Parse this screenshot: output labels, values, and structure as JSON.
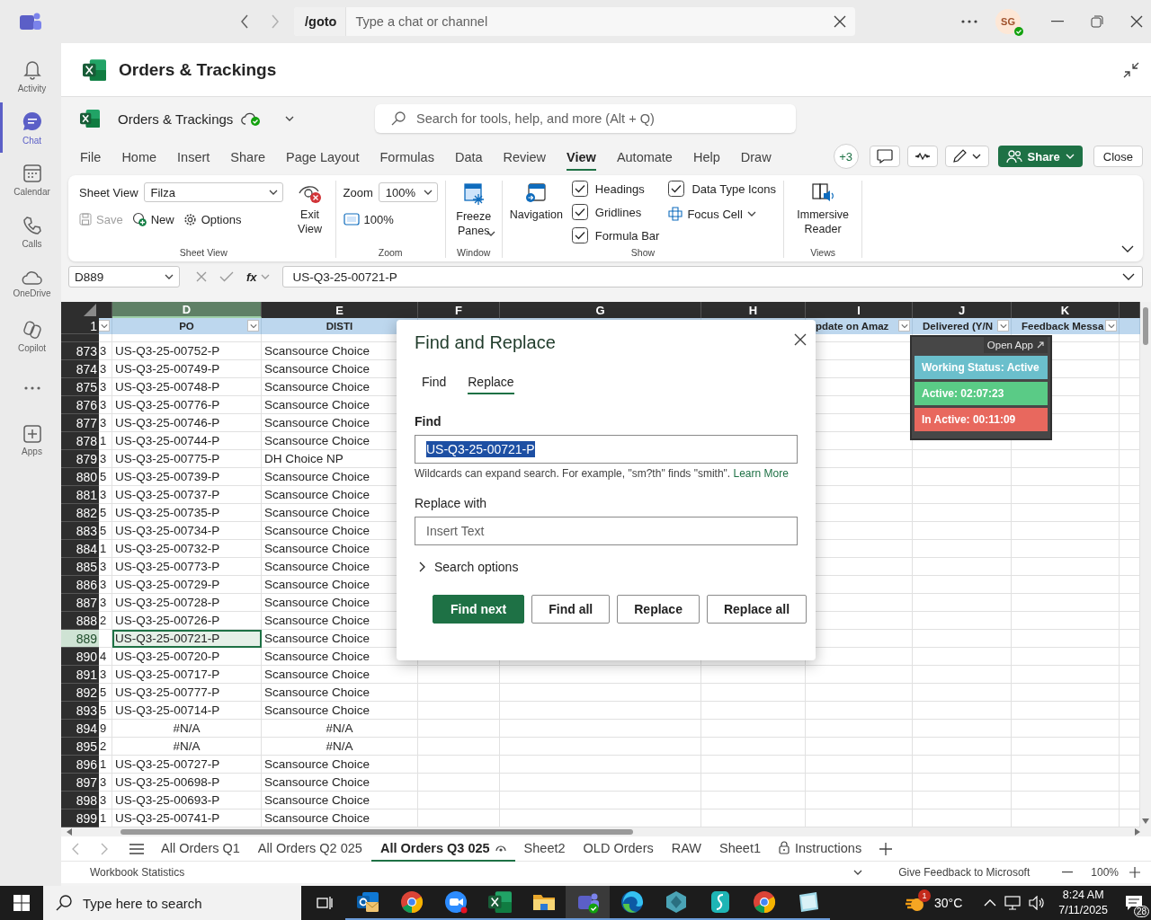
{
  "top": {
    "command": "/goto",
    "search_placeholder": "Type a chat or channel",
    "avatar": "SG"
  },
  "rail": [
    {
      "kind": "activity",
      "label": "Activity",
      "selected": false
    },
    {
      "kind": "chat",
      "label": "Chat",
      "selected": true
    },
    {
      "kind": "calendar",
      "label": "Calendar",
      "selected": false
    },
    {
      "kind": "calls",
      "label": "Calls",
      "selected": false
    },
    {
      "kind": "onedrive",
      "label": "OneDrive",
      "selected": false
    },
    {
      "kind": "copilot",
      "label": "Copilot",
      "selected": false
    },
    {
      "kind": "more",
      "selected": false
    },
    {
      "kind": "apps",
      "label": "Apps",
      "selected": false
    }
  ],
  "title": "Orders & Trackings",
  "workbook": {
    "name": "Orders & Trackings",
    "search_placeholder": "Search for tools, help, and more (Alt + Q)"
  },
  "menu": [
    {
      "label": "File",
      "selected": false
    },
    {
      "label": "Home",
      "selected": false
    },
    {
      "label": "Insert",
      "selected": false
    },
    {
      "label": "Share",
      "selected": false
    },
    {
      "label": "Page Layout",
      "selected": false
    },
    {
      "label": "Formulas",
      "selected": false
    },
    {
      "label": "Data",
      "selected": false
    },
    {
      "label": "Review",
      "selected": false
    },
    {
      "label": "View",
      "selected": true
    },
    {
      "label": "Automate",
      "selected": false
    },
    {
      "label": "Help",
      "selected": false
    },
    {
      "label": "Draw",
      "selected": false
    }
  ],
  "collaborators": "+3",
  "share": "Share",
  "close": "Close",
  "ribbon": {
    "sheet_view": {
      "label": "Sheet View",
      "value": "Filza",
      "actions": [
        {
          "label": "Save",
          "disabled": true
        },
        {
          "label": "New",
          "disabled": false
        },
        {
          "label": "Options",
          "disabled": false
        }
      ],
      "exit": "Exit View",
      "group": "Sheet View"
    },
    "zoom": {
      "label": "Zoom",
      "value": "100%",
      "reset": "100%",
      "group": "Zoom"
    },
    "window": {
      "freeze": "Freeze Panes",
      "group": "Window"
    },
    "show": {
      "navigation": "Navigation",
      "checks": [
        {
          "label": "Headings",
          "checked": true
        },
        {
          "label": "Gridlines",
          "checked": true
        },
        {
          "label": "Formula Bar",
          "checked": true
        },
        {
          "label": "Data Type Icons",
          "checked": true
        }
      ],
      "focus_cell": "Focus Cell",
      "group": "Show"
    },
    "views": {
      "immersive": "Immersive Reader",
      "group": "Views"
    }
  },
  "formula_bar": {
    "name_box": "D889",
    "function_label": "fx",
    "value": "US-Q3-25-00721-P"
  },
  "grid": {
    "header_row_number": "1",
    "columns": [
      {
        "filter": true,
        "selected": false
      },
      {
        "letter": "D",
        "header": "PO",
        "filter": true,
        "selected": true
      },
      {
        "letter": "E",
        "header": "DISTI",
        "filter": false,
        "selected": false
      },
      {
        "letter": "F",
        "filter": false,
        "selected": false
      },
      {
        "letter": "G",
        "filter": false,
        "selected": false
      },
      {
        "letter": "H",
        "filter": false,
        "selected": false
      },
      {
        "letter": "I",
        "header": "pdate on Amaz",
        "filter": true,
        "selected": false
      },
      {
        "letter": "J",
        "header": "Delivered (Y/N",
        "filter": true,
        "selected": false
      },
      {
        "letter": "K",
        "header": "Feedback Messa",
        "filter": true,
        "selected": false
      }
    ],
    "rows": [
      {
        "number": "873",
        "cells": [
          "3",
          "US-Q3-25-00752-P",
          "Scansource Choice"
        ],
        "kind": "text",
        "selected": false
      },
      {
        "number": "874",
        "cells": [
          "3",
          "US-Q3-25-00749-P",
          "Scansource Choice"
        ],
        "kind": "text",
        "selected": false
      },
      {
        "number": "875",
        "cells": [
          "3",
          "US-Q3-25-00748-P",
          "Scansource Choice"
        ],
        "kind": "text",
        "selected": false
      },
      {
        "number": "876",
        "cells": [
          "3",
          "US-Q3-25-00776-P",
          "Scansource Choice"
        ],
        "kind": "text",
        "selected": false
      },
      {
        "number": "877",
        "cells": [
          "3",
          "US-Q3-25-00746-P",
          "Scansource Choice"
        ],
        "kind": "text",
        "selected": false
      },
      {
        "number": "878",
        "cells": [
          "1",
          "US-Q3-25-00744-P",
          "Scansource Choice"
        ],
        "kind": "text",
        "selected": false
      },
      {
        "number": "879",
        "cells": [
          "3",
          "US-Q3-25-00775-P",
          "DH Choice NP"
        ],
        "kind": "text",
        "selected": false
      },
      {
        "number": "880",
        "cells": [
          "5",
          "US-Q3-25-00739-P",
          "Scansource Choice"
        ],
        "kind": "text",
        "selected": false
      },
      {
        "number": "881",
        "cells": [
          "3",
          "US-Q3-25-00737-P",
          "Scansource Choice"
        ],
        "kind": "text",
        "selected": false
      },
      {
        "number": "882",
        "cells": [
          "5",
          "US-Q3-25-00735-P",
          "Scansource Choice"
        ],
        "kind": "text",
        "selected": false
      },
      {
        "number": "883",
        "cells": [
          "5",
          "US-Q3-25-00734-P",
          "Scansource Choice"
        ],
        "kind": "text",
        "selected": false
      },
      {
        "number": "884",
        "cells": [
          "1",
          "US-Q3-25-00732-P",
          "Scansource Choice"
        ],
        "kind": "text",
        "selected": false
      },
      {
        "number": "885",
        "cells": [
          "3",
          "US-Q3-25-00773-P",
          "Scansource Choice"
        ],
        "kind": "text",
        "selected": false
      },
      {
        "number": "886",
        "cells": [
          "3",
          "US-Q3-25-00729-P",
          "Scansource Choice"
        ],
        "kind": "text",
        "selected": false
      },
      {
        "number": "887",
        "cells": [
          "3",
          "US-Q3-25-00728-P",
          "Scansource Choice"
        ],
        "kind": "text",
        "selected": false
      },
      {
        "number": "888",
        "cells": [
          "2",
          "US-Q3-25-00726-P",
          "Scansource Choice"
        ],
        "kind": "text",
        "selected": false
      },
      {
        "number": "889",
        "cells": [
          null,
          "US-Q3-25-00721-P",
          "Scansource Choice"
        ],
        "kind": "text",
        "selected": true
      },
      {
        "number": "890",
        "cells": [
          "4",
          "US-Q3-25-00720-P",
          "Scansource Choice"
        ],
        "kind": "text",
        "selected": false
      },
      {
        "number": "891",
        "cells": [
          "3",
          "US-Q3-25-00717-P",
          "Scansource Choice"
        ],
        "kind": "text",
        "selected": false
      },
      {
        "number": "892",
        "cells": [
          "5",
          "US-Q3-25-00777-P",
          "Scansource Choice"
        ],
        "kind": "text",
        "selected": false
      },
      {
        "number": "893",
        "cells": [
          "5",
          "US-Q3-25-00714-P",
          "Scansource Choice"
        ],
        "kind": "text",
        "selected": false
      },
      {
        "number": "894",
        "cells": [
          "9",
          "#N/A",
          "#N/A"
        ],
        "kind": "error",
        "selected": false
      },
      {
        "number": "895",
        "cells": [
          "2",
          "#N/A",
          "#N/A"
        ],
        "kind": "error",
        "selected": false
      },
      {
        "number": "896",
        "cells": [
          "1",
          "US-Q3-25-00727-P",
          "Scansource Choice"
        ],
        "kind": "text",
        "selected": false
      },
      {
        "number": "897",
        "cells": [
          "3",
          "US-Q3-25-00698-P",
          "Scansource Choice"
        ],
        "kind": "text",
        "selected": false
      },
      {
        "number": "898",
        "cells": [
          "3",
          "US-Q3-25-00693-P",
          "Scansource Choice"
        ],
        "kind": "text",
        "selected": false
      },
      {
        "number": "899",
        "cells": [
          "1",
          "US-Q3-25-00741-P",
          "Scansource Choice"
        ],
        "kind": "text",
        "selected": false
      }
    ]
  },
  "dialog": {
    "title": "Find and Replace",
    "tabs": [
      {
        "label": "Find",
        "selected": false
      },
      {
        "label": "Replace",
        "selected": true
      }
    ],
    "find_label": "Find",
    "find_value": "US-Q3-25-00721-P",
    "hint": "Wildcards can expand search. For example, \"sm?th\" finds \"smith\".",
    "link": "Learn More",
    "replace_label": "Replace with",
    "replace_placeholder": "Insert Text",
    "options": "Search options",
    "buttons": [
      {
        "label": "Find next",
        "kind": "primary"
      },
      {
        "label": "Find all",
        "kind": "secondary"
      },
      {
        "label": "Replace",
        "kind": "secondary"
      },
      {
        "label": "Replace all",
        "kind": "secondary"
      }
    ]
  },
  "tracker": {
    "open_app": "Open App",
    "statuses": [
      {
        "label": "Working Status: Active",
        "color": "#6bbfcc"
      },
      {
        "label": "Active: 02:07:23",
        "color": "#5acb86"
      },
      {
        "label": "In Active: 00:11:09",
        "color": "#e8685e"
      }
    ]
  },
  "sheets": [
    {
      "label": "All Orders Q1",
      "kind": "plain",
      "selected": false
    },
    {
      "label": "All Orders Q2 025",
      "kind": "plain",
      "selected": false
    },
    {
      "label": "All Orders Q3 025",
      "kind": "watched",
      "selected": true
    },
    {
      "label": "Sheet2",
      "kind": "plain",
      "selected": false
    },
    {
      "label": "OLD Orders",
      "kind": "plain",
      "selected": false
    },
    {
      "label": "RAW",
      "kind": "plain",
      "selected": false
    },
    {
      "label": "Sheet1",
      "kind": "plain",
      "selected": false
    },
    {
      "label": "Instructions",
      "kind": "locked",
      "selected": false
    }
  ],
  "status_bar": {
    "left": "Workbook Statistics",
    "feedback": "Give Feedback to Microsoft",
    "zoom": "100%"
  },
  "taskbar": {
    "search_placeholder": "Type here to search",
    "apps": [
      {
        "kind": "outlook",
        "active": false
      },
      {
        "kind": "chrome",
        "active": false
      },
      {
        "kind": "zoom",
        "active": false
      },
      {
        "kind": "excel",
        "active": false
      },
      {
        "kind": "files",
        "active": false
      },
      {
        "kind": "teams",
        "active": true
      },
      {
        "kind": "edge",
        "active": false
      },
      {
        "kind": "hexagon",
        "active": false
      },
      {
        "kind": "surf",
        "active": false
      },
      {
        "kind": "chrome",
        "active": false
      },
      {
        "kind": "notes",
        "active": false
      }
    ],
    "weather_badge": "1",
    "temperature": "30°C",
    "time": "8:24 AM",
    "date": "7/11/2025",
    "notifications": "28"
  }
}
